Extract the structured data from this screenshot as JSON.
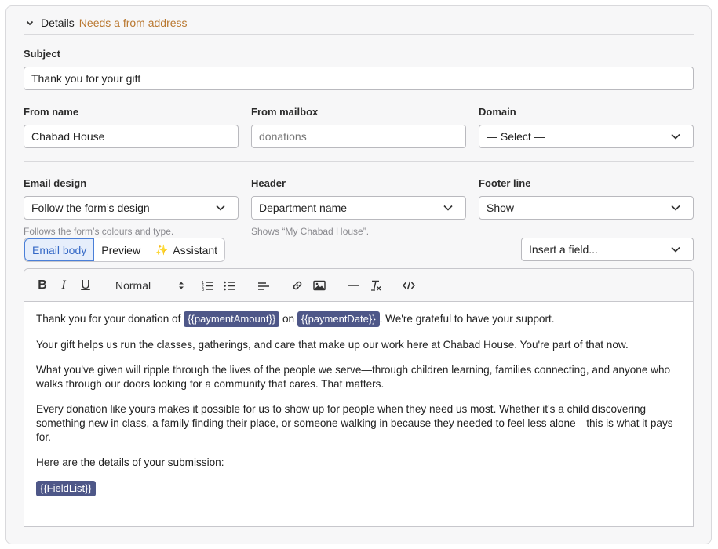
{
  "details": {
    "title": "Details",
    "warning": "Needs a from address"
  },
  "subject": {
    "label": "Subject",
    "value": "Thank you for your gift"
  },
  "from_name": {
    "label": "From name",
    "value": "Chabad House"
  },
  "from_mailbox": {
    "label": "From mailbox",
    "placeholder": "donations"
  },
  "domain": {
    "label": "Domain",
    "value": "— Select —"
  },
  "email_design": {
    "label": "Email design",
    "value": "Follow the form’s design",
    "hint": "Follows the form’s colours and type."
  },
  "header": {
    "label": "Header",
    "value": "Department name",
    "hint": "Shows “My Chabad House”."
  },
  "footer_line": {
    "label": "Footer line",
    "value": "Show"
  },
  "tabs": {
    "email_body": "Email body",
    "preview": "Preview",
    "assistant": "Assistant"
  },
  "insert_field": {
    "value": "Insert a field..."
  },
  "toolbar": {
    "bold": "B",
    "italic": "I",
    "underline": "U",
    "format": "Normal",
    "icons": [
      "bold-icon",
      "italic-icon",
      "underline-icon",
      "ordered-list-icon",
      "bullet-list-icon",
      "align-icon",
      "link-icon",
      "image-icon",
      "horizontal-rule-icon",
      "clear-format-icon",
      "code-icon"
    ]
  },
  "body": {
    "p1_pre": "Thank you for your donation of",
    "p1_chip1": "{{paymentAmount}}",
    "p1_mid": "on",
    "p1_chip2": "{{paymentDate}}",
    "p1_post": ". We're grateful to have your support.",
    "p2": "Your gift helps us run the classes, gatherings, and care that make up our work here at Chabad House. You're part of that now.",
    "p3": "What you've given will ripple through the lives of the people we serve—through children learning, families connecting, and anyone who walks through our doors looking for a community that cares. That matters.",
    "p4": "Every donation like yours makes it possible for us to show up for people when they need us most. Whether it's a child discovering something new in class, a family finding their place, or someone walking in because they needed to feel less alone—this is what it pays for.",
    "p5": "Here are the details of your submission:",
    "chip_fieldlist": "{{FieldList}}"
  },
  "colors": {
    "accent": "#3569c6",
    "warning": "#b9772f",
    "chip": "#4e5788"
  }
}
